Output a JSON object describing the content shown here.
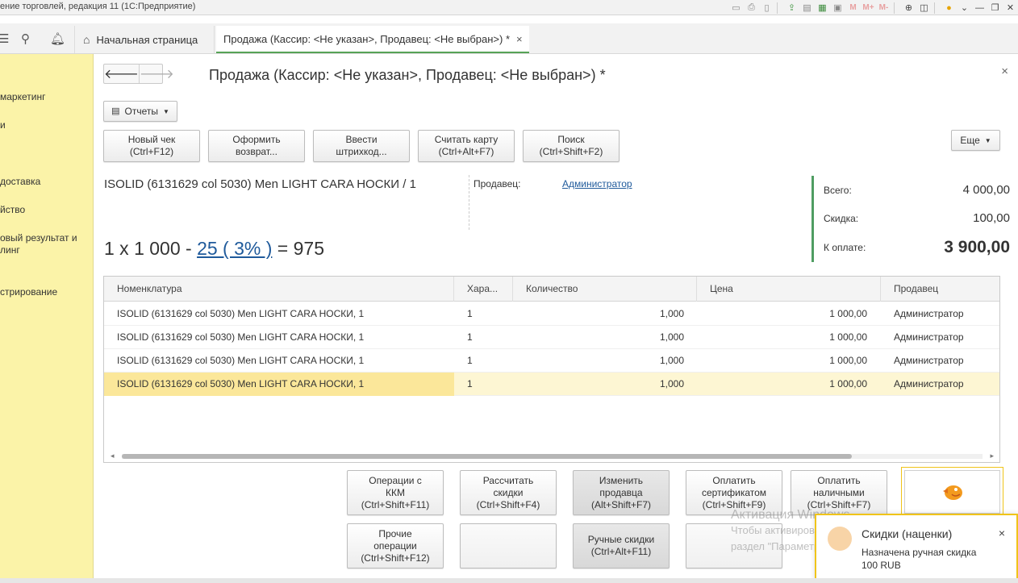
{
  "window": {
    "title": "ение торговлей, редакция 11  (1С:Предприятие)",
    "toolbar_icons": [
      "save-icon",
      "print-icon",
      "preview-icon",
      "upload-icon",
      "print2-icon",
      "calculator-icon",
      "calendar-icon",
      "m-icon",
      "m-plus-icon",
      "m-minus-icon",
      "zoom-icon",
      "panel-icon",
      "info-icon",
      "chevron-down-icon",
      "minimize-icon",
      "restore-icon",
      "close-icon"
    ]
  },
  "tabs": {
    "home_label": "Начальная страница",
    "active_label": "Продажа (Кассир: <Не указан>, Продавец: <Не выбран>) *",
    "close_glyph": "×"
  },
  "sidebar": {
    "items": [
      {
        "label": "маркетинг"
      },
      {
        "label": "и"
      },
      {
        "label": "доставка"
      },
      {
        "label": "йство"
      },
      {
        "label": "овый результат и"
      },
      {
        "label": "линг"
      },
      {
        "label": "стрирование"
      }
    ]
  },
  "form": {
    "title": "Продажа (Кассир: <Не указан>, Продавец: <Не выбран>) *",
    "close": "×",
    "reports_label": "Отчеты",
    "more_label": "Еще",
    "buttons": {
      "new_check": [
        "Новый чек",
        "(Ctrl+F12)"
      ],
      "return": [
        "Оформить",
        "возврат..."
      ],
      "barcode": [
        "Ввести",
        "штрихкод..."
      ],
      "card": [
        "Считать карту",
        "(Ctrl+Alt+F7)"
      ],
      "search": [
        "Поиск",
        "(Ctrl+Shift+F2)"
      ]
    },
    "product_name": "ISOLID (6131629 col 5030) Men LIGHT CARA  НОСКИ / 1",
    "seller_label": "Продавец:",
    "seller_value": "Администратор",
    "calc_prefix": "1 x 1 000 - ",
    "calc_discount": "25 ( 3% )",
    "calc_suffix": " = 975",
    "totals": {
      "total_label": "Всего:",
      "total_value": "4 000,00",
      "discount_label": "Скидка:",
      "discount_value": "100,00",
      "pay_label": "К оплате:",
      "pay_value": "3 900,00"
    }
  },
  "table": {
    "columns": [
      "Номенклатура",
      "Хара...",
      "Количество",
      "Цена",
      "Продавец"
    ],
    "rows": [
      [
        "ISOLID (6131629 col 5030) Men LIGHT CARA  НОСКИ, 1",
        "1",
        "1,000",
        "1 000,00",
        "Администратор"
      ],
      [
        "ISOLID (6131629 col 5030) Men LIGHT CARA  НОСКИ, 1",
        "1",
        "1,000",
        "1 000,00",
        "Администратор"
      ],
      [
        "ISOLID (6131629 col 5030) Men LIGHT CARA  НОСКИ, 1",
        "1",
        "1,000",
        "1 000,00",
        "Администратор"
      ],
      [
        "ISOLID (6131629 col 5030) Men LIGHT CARA  НОСКИ, 1",
        "1",
        "1,000",
        "1 000,00",
        "Администратор"
      ]
    ]
  },
  "actions": {
    "kkm": [
      "Операции с",
      "ККМ",
      "(Ctrl+Shift+F11)"
    ],
    "calc_discounts": [
      "Рассчитать",
      "скидки",
      "(Ctrl+Shift+F4)"
    ],
    "change_seller": [
      "Изменить",
      "продавца",
      "(Alt+Shift+F7)"
    ],
    "pay_cert": [
      "Оплатить",
      "сертификатом",
      "(Ctrl+Shift+F9)"
    ],
    "pay_cash": [
      "Оплатить",
      "наличными",
      "(Ctrl+Shift+F7)"
    ],
    "other_ops": [
      "Прочие",
      "операции",
      "(Ctrl+Shift+F12)"
    ],
    "manual_discounts": [
      "Ручные скидки",
      "(Ctrl+Alt+F11)"
    ]
  },
  "watermark": {
    "line1": "Активация Windows",
    "line2": "Чтобы активировать Windows, перейдите в",
    "line3": "раздел \"Параметры\"."
  },
  "notification": {
    "title": "Скидки (наценки)",
    "text": "Назначена ручная скидка 100 RUB",
    "close": "×"
  },
  "colors": {
    "sidebar_bg": "#fbf3a8",
    "accent_green": "#4f9d62",
    "link_blue": "#1f5a9b",
    "highlight_yellow": "#f0c419"
  }
}
